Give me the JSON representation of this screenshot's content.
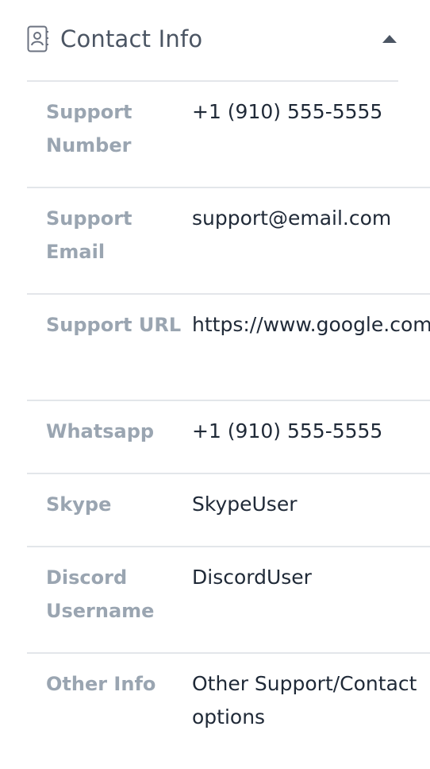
{
  "header": {
    "title": "Contact Info",
    "icon": "contact-card-icon",
    "toggle_icon": "caret-up-icon"
  },
  "rows": [
    {
      "label": "Support Number",
      "value": "+1 (910) 555-5555"
    },
    {
      "label": "Support Email",
      "value": "support@email.com"
    },
    {
      "label": "Support URL",
      "value": "https://www.google.com"
    },
    {
      "label": "Whatsapp",
      "value": "+1 (910) 555-5555"
    },
    {
      "label": "Skype",
      "value": "SkypeUser"
    },
    {
      "label": "Discord Username",
      "value": "DiscordUser"
    },
    {
      "label": "Other Info",
      "value": "Other Support/Contact options"
    }
  ],
  "colors": {
    "title": "#4b5563",
    "label": "#9aa5b1",
    "value": "#1f2937",
    "divider": "#e3e6ea"
  }
}
